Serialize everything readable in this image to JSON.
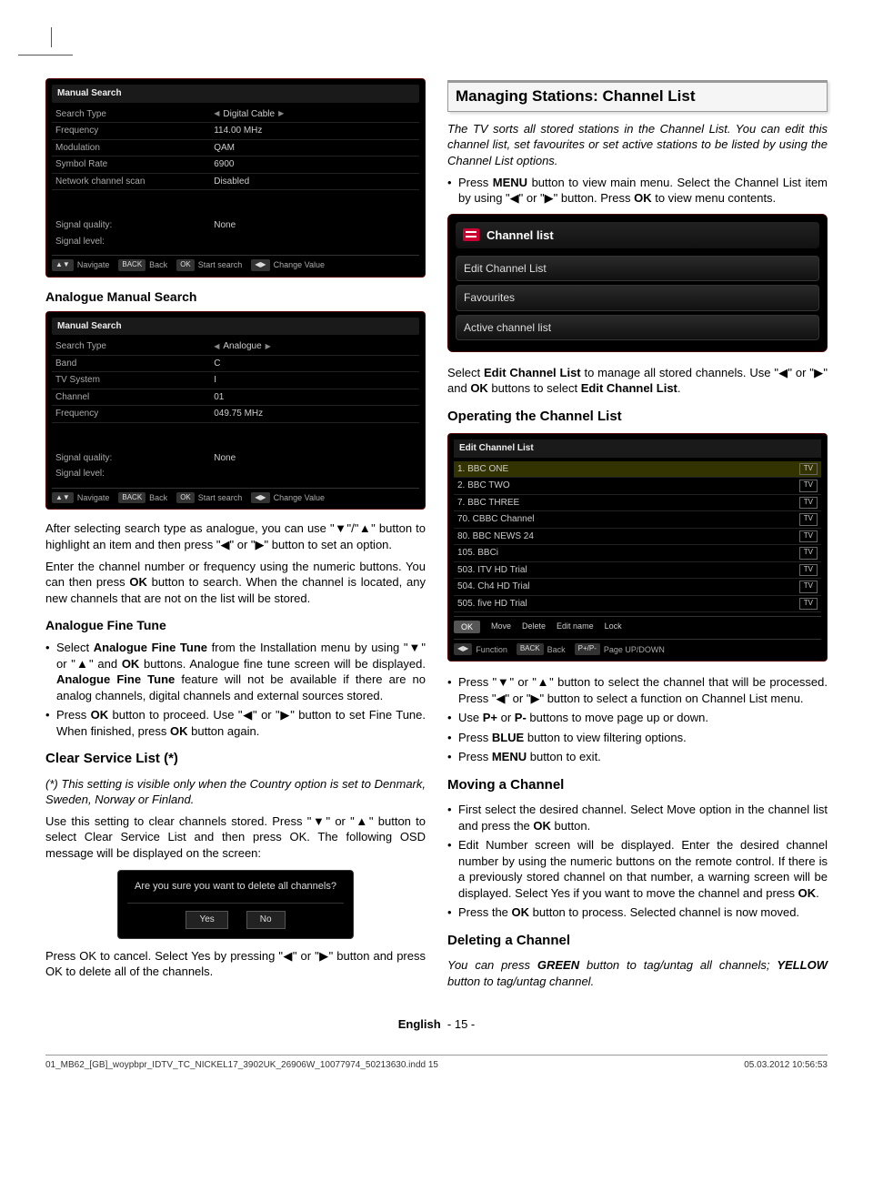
{
  "crop": {},
  "left": {
    "tv1": {
      "title": "Manual Search",
      "rows": [
        {
          "label": "Search Type",
          "val": "Digital Cable",
          "arrows": true
        },
        {
          "label": "Frequency",
          "val": "114.00 MHz"
        },
        {
          "label": "Modulation",
          "val": "QAM"
        },
        {
          "label": "Symbol Rate",
          "val": "6900"
        },
        {
          "label": "Network channel scan",
          "val": "Disabled"
        }
      ],
      "sig1_l": "Signal quality:",
      "sig1_v": "None",
      "sig2_l": "Signal level:",
      "foot": [
        [
          "▲▼",
          "Navigate"
        ],
        [
          "BACK",
          "Back"
        ],
        [
          "OK",
          "Start search"
        ],
        [
          "◀▶",
          "Change Value"
        ]
      ]
    },
    "ams_heading": "Analogue Manual Search",
    "tv2": {
      "title": "Manual Search",
      "rows": [
        {
          "label": "Search Type",
          "val": "Analogue",
          "arrows": true
        },
        {
          "label": "Band",
          "val": "C"
        },
        {
          "label": "TV System",
          "val": "I"
        },
        {
          "label": "Channel",
          "val": "01"
        },
        {
          "label": "Frequency",
          "val": "049.75 MHz"
        }
      ],
      "sig1_l": "Signal quality:",
      "sig1_v": "None",
      "sig2_l": "Signal level:",
      "foot": [
        [
          "▲▼",
          "Navigate"
        ],
        [
          "BACK",
          "Back"
        ],
        [
          "OK",
          "Start search"
        ],
        [
          "◀▶",
          "Change Value"
        ]
      ]
    },
    "para_after": "After selecting search type as analogue, you can use \"▼\"/\"▲\" button to highlight an item and then press \"◀\" or \"▶\" button to set an option.",
    "para_enter": "Enter the channel number or frequency using the numeric buttons. You can then press OK button to search. When the channel is located, any new channels that are not on the list will be stored.",
    "aft_heading": "Analogue Fine Tune",
    "aft_b1": "Select Analogue Fine Tune from the Installation menu by using \"▼\" or \"▲\" and OK buttons. Analogue fine tune screen will be displayed. Analogue Fine Tune feature will not be available if there are no analog channels, digital channels and external sources stored.",
    "aft_b2": "Press OK button to proceed. Use \"◀\" or \"▶\" button to set Fine Tune. When finished, press OK button again.",
    "clear_heading": "Clear Service List (*)",
    "clear_note": "(*) This setting is visible only when the Country option is set to Denmark, Sweden, Norway or Finland.",
    "clear_para": "Use this setting to clear channels stored. Press \"▼\" or \"▲\" button to select Clear Service List and then press OK. The following OSD message will be displayed on the screen:",
    "dialog_text": "Are you sure you want to delete all channels?",
    "dialog_yes": "Yes",
    "dialog_no": "No",
    "clear_end": "Press OK to cancel. Select Yes by pressing \"◀\" or \"▶\" button and press OK to delete all of the channels."
  },
  "right": {
    "title": "Managing Stations: Channel List",
    "intro1": "The TV sorts all stored stations in the Channel List. You can edit this channel list, set favourites or set active stations to be listed by using the Channel List options.",
    "b1": "Press MENU button to view main menu. Select the Channel List item by using \"◀\" or \"▶\" button. Press OK to view menu contents.",
    "menu": {
      "head": "Channel list",
      "items": [
        "Edit Channel List",
        "Favourites",
        "Active channel list"
      ]
    },
    "select_para": "Select Edit Channel List to manage all stored channels. Use \"◀\" or \"▶\" and OK buttons to select Edit Channel List.",
    "op_heading": "Operating the Channel List",
    "chlist": {
      "head": "Edit Channel List",
      "rows": [
        {
          "num": "1.",
          "name": "BBC ONE",
          "t": "TV",
          "sel": true
        },
        {
          "num": "2.",
          "name": "BBC TWO",
          "t": "TV"
        },
        {
          "num": "7.",
          "name": "BBC THREE",
          "t": "TV"
        },
        {
          "num": "70.",
          "name": "CBBC Channel",
          "t": "TV"
        },
        {
          "num": "80.",
          "name": "BBC NEWS 24",
          "t": "TV"
        },
        {
          "num": "105.",
          "name": "BBCi",
          "t": "TV"
        },
        {
          "num": "503.",
          "name": "ITV HD Trial",
          "t": "TV"
        },
        {
          "num": "504.",
          "name": "Ch4 HD Trial",
          "t": "TV"
        },
        {
          "num": "505.",
          "name": "five HD Trial",
          "t": "TV"
        }
      ],
      "actions": [
        "OK",
        "Move",
        "Delete",
        "Edit name",
        "Lock"
      ],
      "foot": [
        [
          "◀▶",
          "Function"
        ],
        [
          "BACK",
          "Back"
        ],
        [
          "P+/P-",
          "Page UP/DOWN"
        ]
      ]
    },
    "op_b1": "Press \"▼\" or \"▲\" button to select the channel that will be processed. Press \"◀\" or \"▶\" button to select a function on Channel List menu.",
    "op_b2": "Use P+ or P- buttons to move page up or down.",
    "op_b3": "Press BLUE button to view filtering options.",
    "op_b4": "Press MENU button to exit.",
    "move_heading": "Moving a Channel",
    "move_b1": "First select the desired channel. Select Move option in the channel list and press the OK button.",
    "move_b2": "Edit Number screen will be displayed. Enter the desired channel number by using the numeric buttons on the remote control. If there is a previously stored channel on that number, a warning screen will be displayed. Select Yes if you want to move the channel and press OK.",
    "move_b3": "Press the OK button to process. Selected channel is now moved.",
    "del_heading": "Deleting a Channel",
    "del_para": "You can press GREEN button to tag/untag all channels; YELLOW button to tag/untag channel."
  },
  "footer": {
    "center_lang": "English",
    "center_page": "- 15 -",
    "file": "01_MB62_[GB]_woypbpr_IDTV_TC_NICKEL17_3902UK_26906W_10077974_50213630.indd   15",
    "date": "05.03.2012   10:56:53"
  }
}
